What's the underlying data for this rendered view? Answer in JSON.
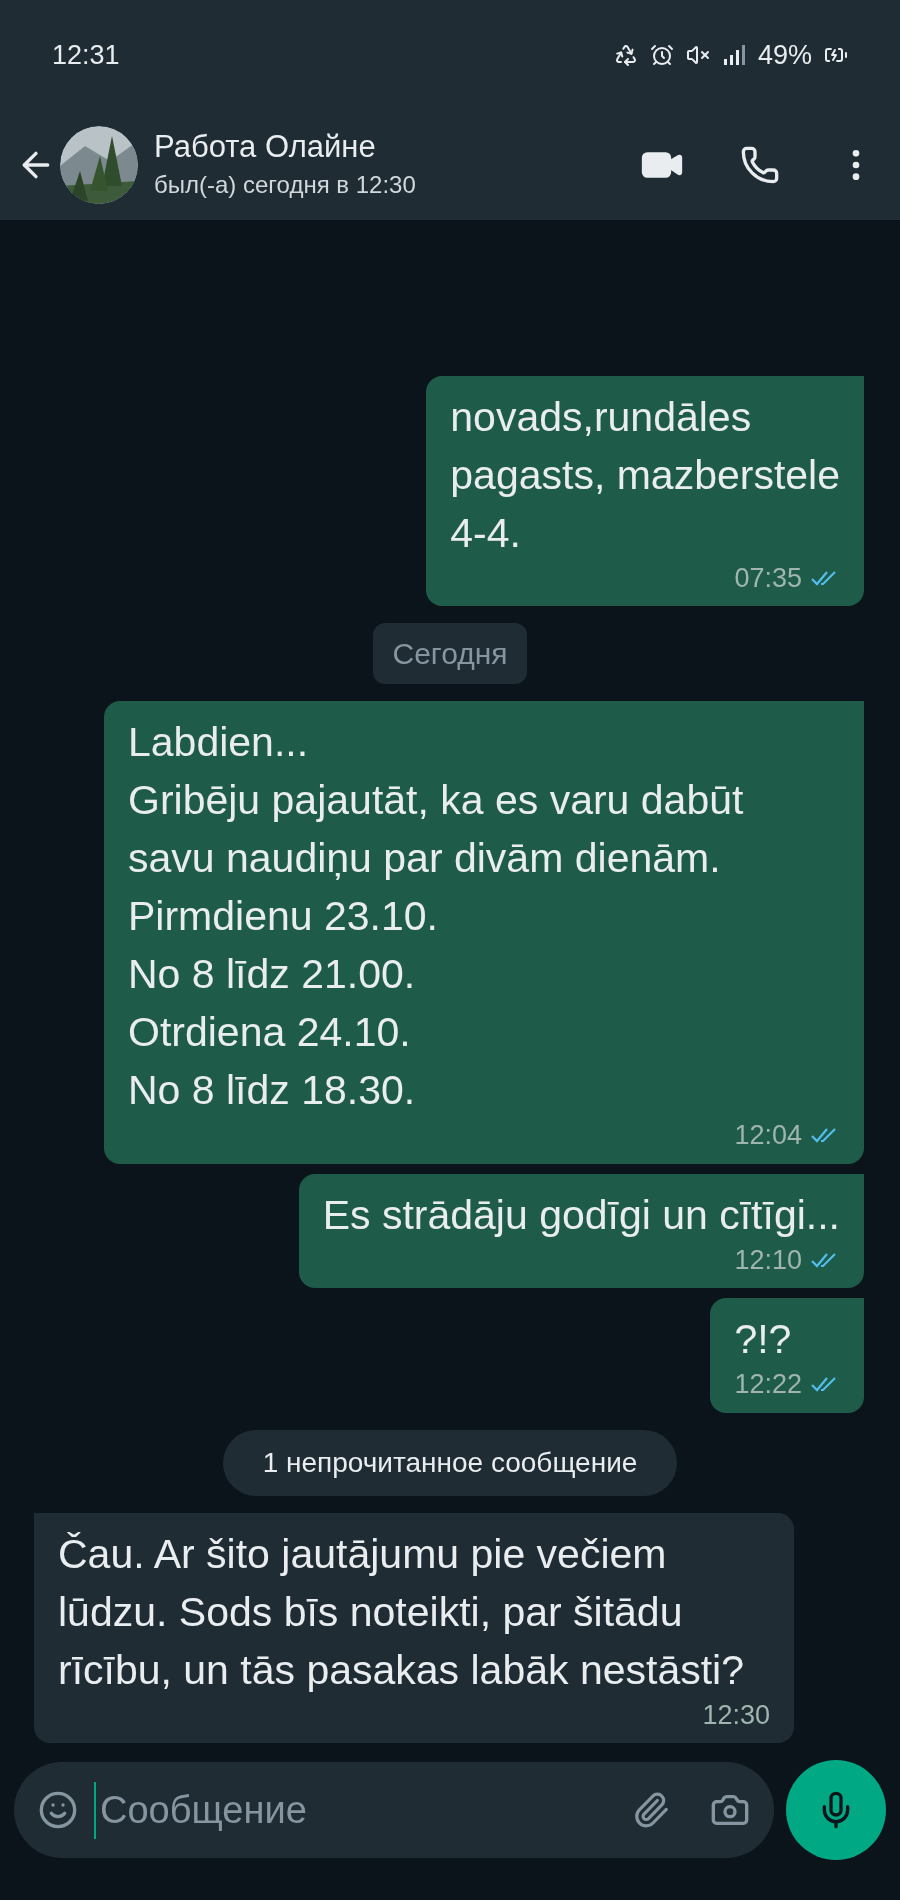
{
  "status_bar": {
    "time": "12:31",
    "battery": "49%"
  },
  "header": {
    "name": "Работа Олайне",
    "last_seen": "был(-а) сегодня в 12:30"
  },
  "messages": [
    {
      "kind": "outgoing",
      "text": "novads,rundāles\npagasts, mazberstele\n4-4.",
      "time": "07:35",
      "read": true
    },
    {
      "kind": "date",
      "text": "Сегодня"
    },
    {
      "kind": "outgoing",
      "text": "Labdien...\nGribēju pajautāt, ka es varu dabūt savu naudiņu par divām dienām.\nPirmdienu 23.10.\nNo 8 līdz 21.00.\nOtrdiena 24.10.\nNo 8 līdz 18.30.",
      "time": "12:04",
      "read": true
    },
    {
      "kind": "outgoing",
      "text": "Es strādāju godīgi un cītīgi...",
      "time": "12:10",
      "read": true
    },
    {
      "kind": "outgoing",
      "text": "?!?",
      "time": "12:22",
      "read": true
    },
    {
      "kind": "unread",
      "text": "1 непрочитанное сообщение"
    },
    {
      "kind": "incoming",
      "text": "Čau. Ar šito jautājumu pie večiem lūdzu. Sods bīs noteikti, par šitādu rīcību, un tās pasakas labāk nestāsti?",
      "time": "12:30"
    }
  ],
  "composer": {
    "placeholder": "Сообщение"
  }
}
